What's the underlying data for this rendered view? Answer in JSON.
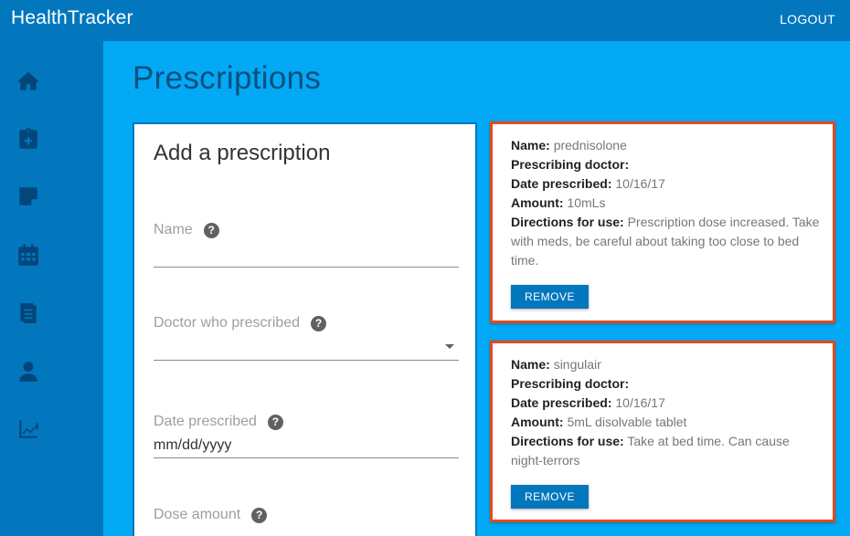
{
  "app": {
    "title": "HealthTracker",
    "logout_label": "LOGOUT"
  },
  "sidebar": {
    "items": [
      {
        "icon": "home-icon"
      },
      {
        "icon": "clipboard-plus-icon"
      },
      {
        "icon": "note-icon"
      },
      {
        "icon": "calendar-icon"
      },
      {
        "icon": "document-icon"
      },
      {
        "icon": "doctor-icon"
      },
      {
        "icon": "trending-up-icon"
      }
    ]
  },
  "page": {
    "title": "Prescriptions"
  },
  "form": {
    "title": "Add a prescription",
    "fields": {
      "name": {
        "label": "Name",
        "value": ""
      },
      "doctor": {
        "label": "Doctor who prescribed",
        "value": ""
      },
      "date": {
        "label": "Date prescribed",
        "value": "mm/dd/yyyy"
      },
      "dose": {
        "label": "Dose amount"
      }
    }
  },
  "labels": {
    "name": "Name:",
    "doctor": "Prescribing doctor:",
    "date": "Date prescribed:",
    "amount": "Amount:",
    "directions": "Directions for use:"
  },
  "prescriptions": [
    {
      "name": "prednisolone",
      "doctor": "",
      "date": "10/16/17",
      "amount": "10mLs",
      "directions": "Prescription dose increased. Take with meds, be careful about taking too close to bed time.",
      "remove_label": "REMOVE"
    },
    {
      "name": "singulair",
      "doctor": "",
      "date": "10/16/17",
      "amount": "5mL disolvable tablet",
      "directions": "Take at bed time. Can cause night-terrors",
      "remove_label": "REMOVE"
    }
  ],
  "colors": {
    "header": "#0277bd",
    "background": "#03a9f4",
    "card_border": "#e64a19",
    "button": "#0277bd"
  }
}
